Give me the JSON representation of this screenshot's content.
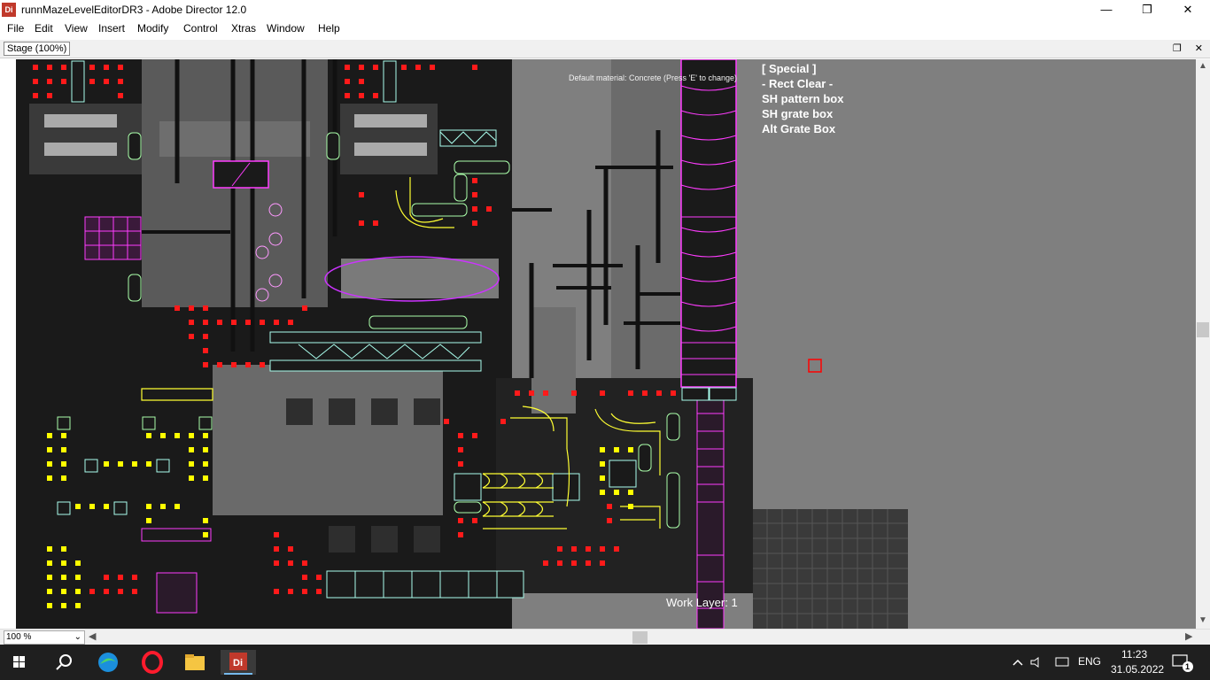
{
  "window": {
    "app_icon_text": "Di",
    "title": "runnMazeLevelEditorDR3 - Adobe Director 12.0",
    "minimize": "—",
    "maximize": "❐",
    "close": "✕"
  },
  "menubar": {
    "items": [
      "File",
      "Edit",
      "View",
      "Insert",
      "Modify",
      "Control",
      "Xtras",
      "Window",
      "Help"
    ]
  },
  "stage": {
    "title": "Stage (100%)",
    "restore": "❐",
    "close": "✕",
    "default_material": "Default material: Concrete (Press 'E' to change)",
    "special_menu": [
      "[ Special ]",
      "- Rect Clear -",
      "SH pattern box",
      "SH grate box",
      "Alt Grate Box"
    ],
    "work_layer": "Work Layer: 1"
  },
  "statusbar": {
    "zoom": "100 %"
  },
  "taskbar": {
    "language": "ENG",
    "time": "11:23",
    "date": "31.05.2022",
    "notification_count": "1",
    "apps": [
      "start-icon",
      "search-icon",
      "edge-icon",
      "opera-icon",
      "file-explorer-icon",
      "director-icon"
    ]
  },
  "colors": {
    "accent_red": "#ff0000",
    "accent_yellow": "#ffff00",
    "accent_magenta": "#ff00ff",
    "accent_cyan": "#88ffee",
    "accent_green": "#aaffaa",
    "canvas_gray": "#808080"
  }
}
